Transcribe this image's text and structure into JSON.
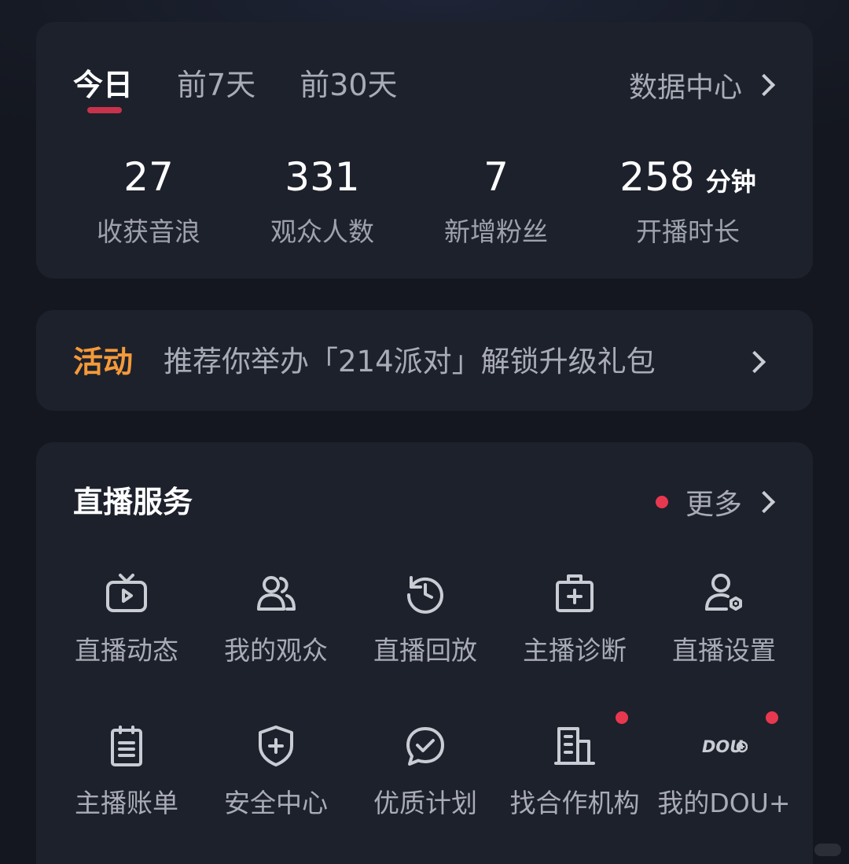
{
  "stats_card": {
    "tabs": [
      {
        "label": "今日",
        "active": true
      },
      {
        "label": "前7天",
        "active": false
      },
      {
        "label": "前30天",
        "active": false
      }
    ],
    "data_center_label": "数据中心",
    "stats": [
      {
        "value": "27",
        "unit": "",
        "label": "收获音浪"
      },
      {
        "value": "331",
        "unit": "",
        "label": "观众人数"
      },
      {
        "value": "7",
        "unit": "",
        "label": "新增粉丝"
      },
      {
        "value": "258",
        "unit": "分钟",
        "label": "开播时长"
      }
    ]
  },
  "activity": {
    "tag": "活动",
    "text": "推荐你举办「214派对」解锁升级礼包"
  },
  "services": {
    "title": "直播服务",
    "more_label": "更多",
    "items": [
      {
        "label": "直播动态",
        "icon": "tv-play-icon"
      },
      {
        "label": "我的观众",
        "icon": "users-icon"
      },
      {
        "label": "直播回放",
        "icon": "history-icon"
      },
      {
        "label": "主播诊断",
        "icon": "medical-kit-icon"
      },
      {
        "label": "直播设置",
        "icon": "user-settings-icon"
      },
      {
        "label": "主播账单",
        "icon": "bill-icon"
      },
      {
        "label": "安全中心",
        "icon": "shield-plus-icon"
      },
      {
        "label": "优质计划",
        "icon": "check-badge-icon"
      },
      {
        "label": "找合作机构",
        "icon": "building-icon",
        "badge": true
      },
      {
        "label": "我的DOU+",
        "icon": "dou-plus-icon",
        "badge": true
      }
    ],
    "dou_icon_text": "DOU"
  },
  "colors": {
    "background": "#161a24",
    "card": "#1d212c",
    "accent_red": "#e8384f",
    "tab_underline": "#c7334b",
    "activity_orange": "#f59a3a",
    "text_primary": "#ffffff",
    "text_secondary": "#a9acb5"
  }
}
